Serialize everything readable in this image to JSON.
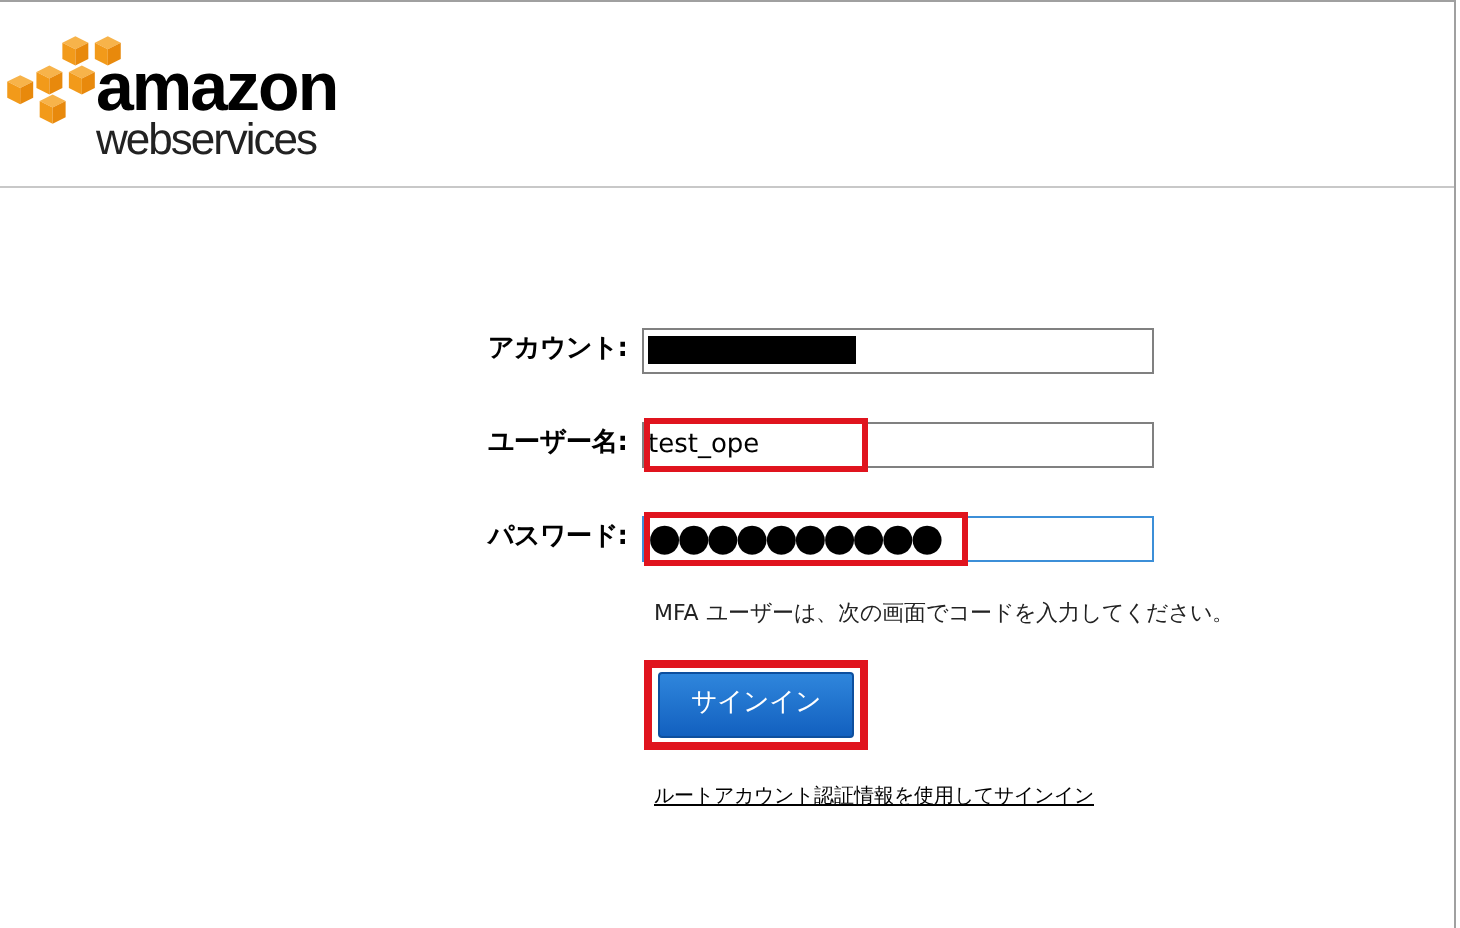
{
  "logo": {
    "line_1": "amazon",
    "line_2": "webservices"
  },
  "fields": [
    {
      "label": "アカウント:",
      "kind": "redacted",
      "highlighted": false,
      "focused": false
    },
    {
      "label": "ユーザー名:",
      "kind": "text",
      "value": "test_ope",
      "highlighted": true,
      "focused": false
    },
    {
      "label": "パスワード:",
      "kind": "text",
      "value": "●●●●●●●●●●",
      "highlighted": true,
      "focused": true
    }
  ],
  "note": "MFA ユーザーは、次の画面でコードを入力してください。",
  "sign_in_button": {
    "label": "サインイン",
    "highlighted": true
  },
  "root_link": "ルートアカウント認証情報を使用してサインイン"
}
